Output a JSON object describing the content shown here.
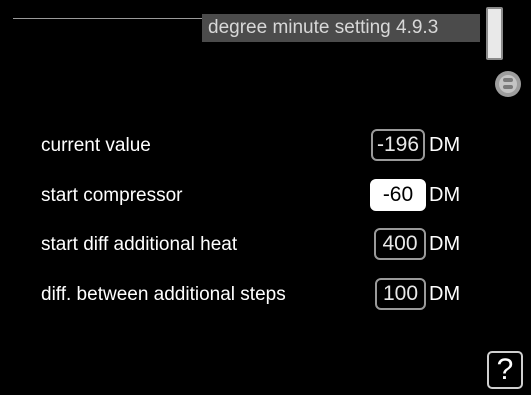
{
  "header": {
    "title": "degree minute setting 4.9.3"
  },
  "rows": [
    {
      "label": "current value",
      "value": "-196",
      "unit": "DM"
    },
    {
      "label": "start compressor",
      "value": "-60",
      "unit": "DM",
      "selected": true
    },
    {
      "label": "start diff additional heat",
      "value": "400",
      "unit": "DM"
    },
    {
      "label": "diff. between additional steps",
      "value": "100",
      "unit": "DM"
    }
  ],
  "help": {
    "label": "?"
  },
  "icons": {
    "scroll": "scrollbar-thumb",
    "thumb": "thumb-icon",
    "help": "help-icon"
  }
}
